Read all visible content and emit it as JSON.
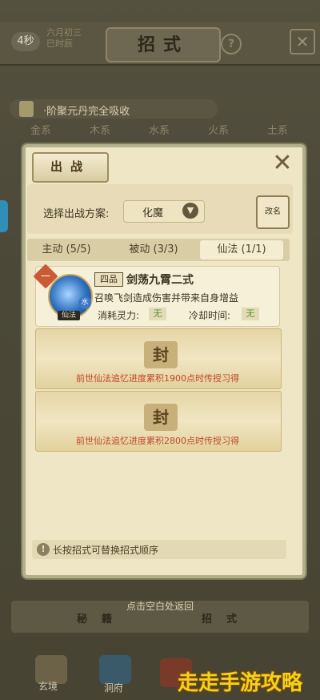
{
  "header": {
    "timer": "4秒",
    "date_line1": "六月初三",
    "date_line2": "巳时辰",
    "title": "招式",
    "help": "?"
  },
  "notice": "·阶聚元丹完全吸收",
  "element_tabs": [
    "金系",
    "木系",
    "水系",
    "火系",
    "土系"
  ],
  "panel": {
    "title": "出战",
    "scheme_label": "选择出战方案:",
    "scheme_value": "化魔",
    "rename_label": "改名",
    "tabs": [
      {
        "label": "主动 (5/5)"
      },
      {
        "label": "被动 (3/3)"
      },
      {
        "label": "仙法 (1/1)"
      }
    ],
    "skill": {
      "slot": "一",
      "grade": "四品",
      "name": "剑荡九霄二式",
      "desc": "召唤飞剑造成伤害并带来自身增益",
      "element_tag": "水",
      "type_tag": "仙法",
      "cost_label": "消耗灵力:",
      "cost_value": "无",
      "cd_label": "冷却时间:",
      "cd_value": "无"
    },
    "locked": [
      {
        "seal": "封",
        "text": "前世仙法追忆进度累积1900点时传授习得"
      },
      {
        "seal": "封",
        "text": "前世仙法追忆进度累积2800点时传授习得"
      }
    ],
    "hint": "长按招式可替换招式顺序"
  },
  "bottom": {
    "hint": "点击空白处返回",
    "btn_left": "秘籍",
    "btn_right": "招式",
    "nav": [
      "玄境",
      "洞府"
    ]
  },
  "watermark": "走走手游攻略",
  "colors": {
    "accent": "#c4462a",
    "free_green": "#4d9a2d",
    "panel_bg": "#efe6c6"
  }
}
